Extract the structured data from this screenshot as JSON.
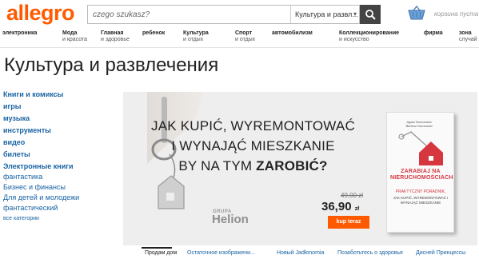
{
  "header": {
    "logo": "allegro",
    "search_placeholder": "czego szukasz?",
    "search_category": "Культура и развл...",
    "cart_label": "корзина пуста"
  },
  "nav": [
    {
      "l1": "электроника",
      "l2": ""
    },
    {
      "l1": "Мода",
      "l2": "и красота"
    },
    {
      "l1": "Главная",
      "l2": "и здоровье"
    },
    {
      "l1": "ребенок",
      "l2": ""
    },
    {
      "l1": "Культура",
      "l2": "и отдых"
    },
    {
      "l1": "Спорт",
      "l2": "и отдых"
    },
    {
      "l1": "автомобилизм",
      "l2": ""
    },
    {
      "l1": "Коллекционирование",
      "l2": "и искусство"
    },
    {
      "l1": "фирма",
      "l2": ""
    },
    {
      "l1": "зона",
      "l2": "случай"
    }
  ],
  "page_title": "Культура и развлечения",
  "sidebar": [
    {
      "label": "Книги и комиксы",
      "style": "bold"
    },
    {
      "label": "игры",
      "style": "bold"
    },
    {
      "label": "музыка",
      "style": "bold"
    },
    {
      "label": "инструменты",
      "style": "bold"
    },
    {
      "label": "видео",
      "style": "bold"
    },
    {
      "label": "билеты",
      "style": "bold"
    },
    {
      "label": "Электронные книги",
      "style": "bold"
    },
    {
      "label": "фантастика",
      "style": "reg"
    },
    {
      "label": "Бизнес и финансы",
      "style": "reg"
    },
    {
      "label": "Для детей и молодежи",
      "style": "reg"
    },
    {
      "label": "фантастический",
      "style": "reg"
    },
    {
      "label": "все категории",
      "style": "small"
    }
  ],
  "banner": {
    "headline_l1": "JAK KUPIĆ, WYREMONTOWAĆ",
    "headline_l2": "I WYNAJĄĆ MIESZKANIE",
    "headline_l3_pre": "BY NA TYM ",
    "headline_l3_bold": "ZAROBIĆ?",
    "publisher_grupa": "GRUPA",
    "publisher_name": "Helion",
    "old_price": "49,00 zł",
    "new_price": "36,90",
    "currency": "zł",
    "buy_label": "kup teraz",
    "book_authors": "Agata Domowska\nBartosz Domowski",
    "book_title": "ZARABIAJ NA NIERUCHOMOŚCIACH",
    "book_subtitle": "PRAKTYCZNY PORADNIK,",
    "book_subtitle2": "JAK KUPIĆ, WYREMONTOWAĆ I WYNAJĄĆ MIESZKANIE"
  },
  "tabs": [
    {
      "label": "Продам дом",
      "active": true
    },
    {
      "label": "Остаточное изображени...",
      "active": false
    },
    {
      "label": "Новый Jadłonomia",
      "active": false
    },
    {
      "label": "Позаботьтесь о здоровье",
      "active": false
    },
    {
      "label": "Дисней Принцессы",
      "active": false
    }
  ],
  "colors": {
    "brand": "#ff5a00",
    "link": "#1863a3",
    "book_red": "#d6373f"
  }
}
